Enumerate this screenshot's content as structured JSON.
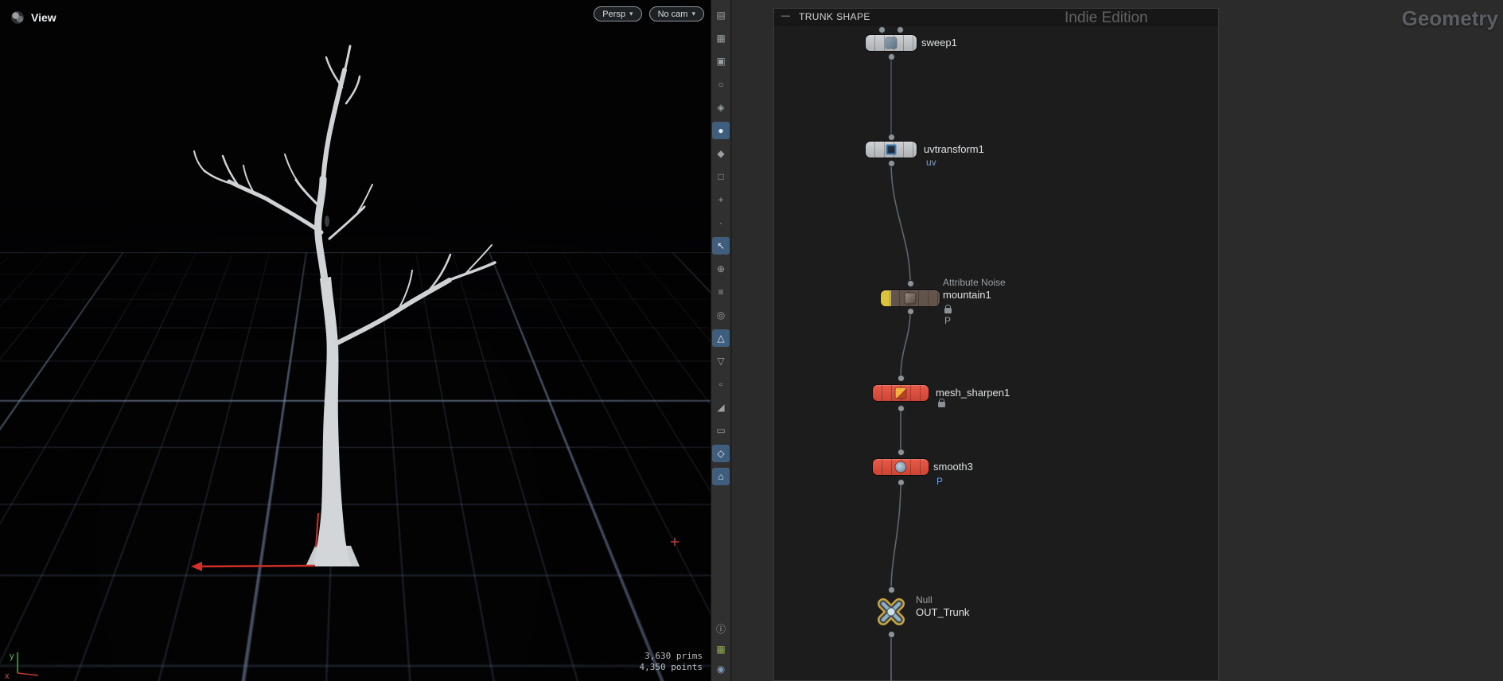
{
  "viewport": {
    "title": "View",
    "camera_menu_label": "Persp",
    "camera_select_label": "No cam",
    "caret": "▾",
    "stats_prims": "3,630  prims",
    "stats_points": "4,350  points",
    "axis_x": "x",
    "axis_y": "y"
  },
  "toolbar": {
    "icons": [
      {
        "g": "▤",
        "name": "pane-layout-icon",
        "hl": false
      },
      {
        "g": "▦",
        "name": "snap-grid-icon",
        "hl": false
      },
      {
        "g": "▣",
        "name": "lock-icon",
        "hl": false
      },
      {
        "g": "○",
        "name": "radial-menu-icon",
        "hl": false
      },
      {
        "g": "◈",
        "name": "display-options-icon",
        "hl": false
      },
      {
        "g": "●",
        "name": "view-tool-icon",
        "hl": true
      },
      {
        "g": "◆",
        "name": "select-geometry-icon",
        "hl": false
      },
      {
        "g": "□",
        "name": "box-select-icon",
        "hl": false
      },
      {
        "g": "+",
        "name": "move-tool-icon",
        "hl": false
      },
      {
        "g": "·",
        "name": "divider-dot-icon",
        "hl": false
      },
      {
        "g": "↖",
        "name": "select-arrow-icon",
        "hl": true
      },
      {
        "g": "⊕",
        "name": "translate-handle-icon",
        "hl": false
      },
      {
        "g": "≡",
        "name": "handle-list-icon",
        "hl": false
      },
      {
        "g": "◎",
        "name": "rotate-tool-icon",
        "hl": false
      },
      {
        "g": "△",
        "name": "scale-tool-icon",
        "hl": true
      },
      {
        "g": "▽",
        "name": "falloff-icon",
        "hl": false
      },
      {
        "g": "▫",
        "name": "small-grid-icon",
        "hl": false
      },
      {
        "g": "◢",
        "name": "corner-pin-icon",
        "hl": false
      },
      {
        "g": "▭",
        "name": "flatten-icon",
        "hl": false
      },
      {
        "g": "◇",
        "name": "soft-select-icon",
        "hl": true
      },
      {
        "g": "⌂",
        "name": "home-view-icon",
        "hl": true
      }
    ],
    "bottom_icons": [
      {
        "g": "ⓘ",
        "name": "info-icon",
        "cls": "c-info"
      },
      {
        "g": "▦",
        "name": "cook-mode-icon",
        "cls": "c-cook"
      },
      {
        "g": "◉",
        "name": "snapshot-icon",
        "cls": "c-snap"
      }
    ]
  },
  "network": {
    "box_title": "TRUNK SHAPE",
    "box_collapse_glyph": "—",
    "watermark": "Indie Edition",
    "context_label": "Geometry",
    "nodes": {
      "sweep": {
        "name": "sweep1"
      },
      "uvtransform": {
        "name": "uvtransform1",
        "out_tag": "uv"
      },
      "mountain": {
        "type": "Attribute Noise",
        "name": "mountain1",
        "out_tag": "P"
      },
      "mesh_sharpen": {
        "name": "mesh_sharpen1"
      },
      "smooth": {
        "name": "smooth3",
        "out_tag": "P"
      },
      "out_null": {
        "type": "Null",
        "name": "OUT_Trunk"
      }
    }
  },
  "colors": {
    "accent_blue": "#3f5e7e",
    "node_gray": "#c2c6c8",
    "node_red": "#d94f3f",
    "flag_yellow": "#dcc43a",
    "wire": "#5c6870",
    "tag_blue": "#6f9fd8",
    "axis_red": "#d03028",
    "axis_green": "#3da83d"
  }
}
